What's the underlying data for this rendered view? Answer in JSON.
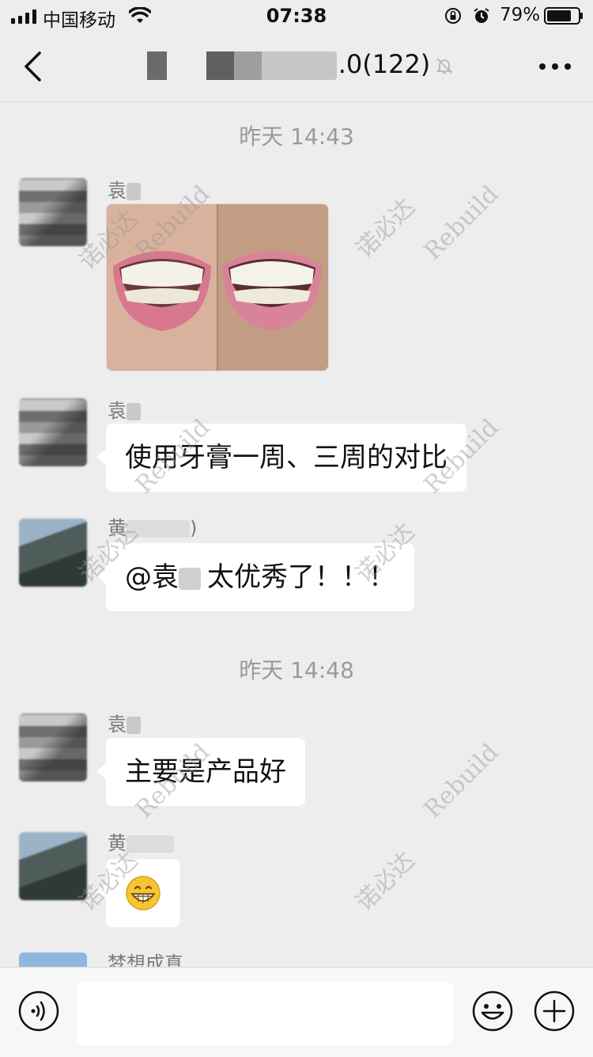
{
  "status_bar": {
    "carrier": "中国移动",
    "time": "07:38",
    "battery": "79%"
  },
  "header": {
    "title_suffix": ".0(122)",
    "back_icon": "chevron-left-icon",
    "mute_icon": "bell-muted-icon",
    "more_icon": "more-dots-icon"
  },
  "messages": {
    "ts1": "昨天 14:43",
    "m1_sender": "袁",
    "m2_sender": "袁",
    "m2_text": "使用牙膏一周、三周的对比",
    "m3_sender": "黄",
    "m3_sender_tail": ")",
    "m3_text": "@袁 太优秀了！！！",
    "m3_text_mention": "@袁",
    "m3_text_body": "太优秀了！！！",
    "ts2": "昨天 14:48",
    "m4_sender": "袁",
    "m4_text": "主要是产品好",
    "m5_sender": "黄",
    "m5_emoji": "grinning-face-emoji",
    "m6_sender": "梦想成真"
  },
  "watermark": {
    "latin": "Rebuild",
    "cn": "诺必达"
  },
  "input_bar": {
    "voice_icon": "voice-icon",
    "emoji_icon": "emoji-icon",
    "plus_icon": "plus-icon"
  }
}
